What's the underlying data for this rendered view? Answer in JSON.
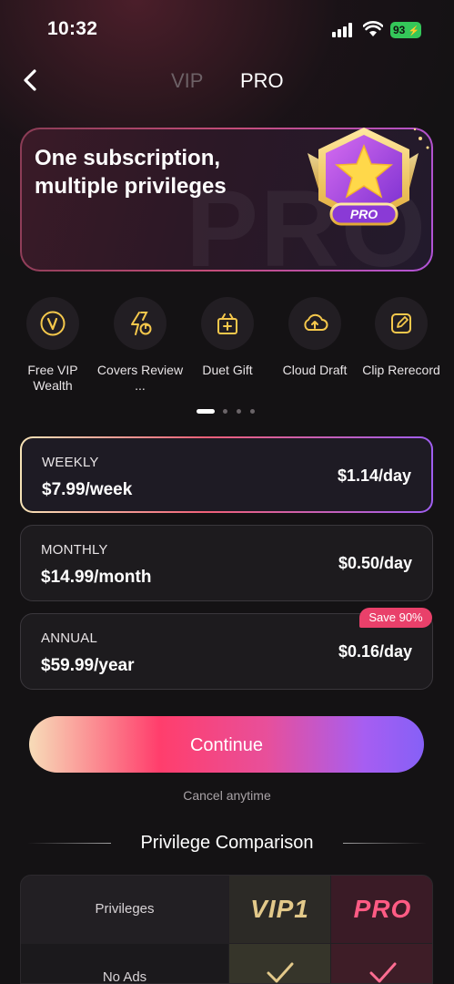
{
  "status_bar": {
    "time": "10:32",
    "battery": "93"
  },
  "header": {
    "tabs": [
      {
        "label": "VIP",
        "active": false
      },
      {
        "label": "PRO",
        "active": true
      }
    ]
  },
  "hero": {
    "title": "One subscription, multiple privileges",
    "badge_label": "PRO",
    "watermark": "PRO"
  },
  "features": [
    {
      "label": "Free VIP Wealth",
      "icon": "v-coin-icon"
    },
    {
      "label": "Covers Review ...",
      "icon": "lightning-note-icon"
    },
    {
      "label": "Duet Gift",
      "icon": "gift-icon"
    },
    {
      "label": "Cloud Draft",
      "icon": "cloud-upload-icon"
    },
    {
      "label": "Clip Rerecord",
      "icon": "edit-icon"
    }
  ],
  "pager": {
    "pages": 4,
    "current": 1
  },
  "plans": [
    {
      "name": "WEEKLY",
      "price": "$7.99/week",
      "per_day": "$1.14/day",
      "selected": true
    },
    {
      "name": "MONTHLY",
      "price": "$14.99/month",
      "per_day": "$0.50/day",
      "selected": false
    },
    {
      "name": "ANNUAL",
      "price": "$59.99/year",
      "per_day": "$0.16/day",
      "selected": false,
      "badge": "Save 90%"
    }
  ],
  "cta": {
    "label": "Continue",
    "note": "Cancel anytime"
  },
  "comparison": {
    "title": "Privilege Comparison",
    "header": {
      "col1": "Privileges",
      "col2": "VIP1",
      "col3": "PRO"
    },
    "rows": [
      {
        "label": "No Ads",
        "vip": true,
        "pro": true
      }
    ]
  },
  "colors": {
    "accent_pink": "#ff3e6c",
    "accent_purple": "#8660f6",
    "gold": "#e3c98a",
    "save_badge": "#e9406a"
  }
}
